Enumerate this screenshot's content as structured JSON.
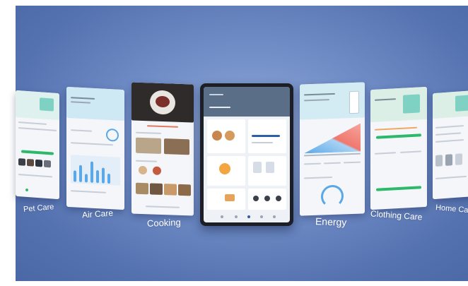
{
  "labels": {
    "pet_care": "Pet Care",
    "air_care": "Air Care",
    "cooking": "Cooking",
    "energy": "Energy",
    "clothing_care": "Clothing Care",
    "home_care": "Home Ca"
  },
  "colors": {
    "background": "#6f8cc6",
    "accent_green": "#2db86a",
    "accent_teal": "#7fd1c4",
    "energy_red": "#f0786e",
    "energy_blue": "#5aa8e8",
    "center_header": "#5a6e88"
  }
}
